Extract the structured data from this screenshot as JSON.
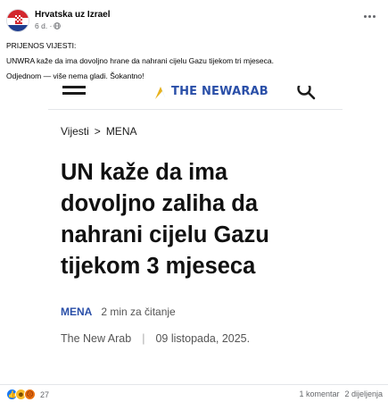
{
  "post": {
    "page_name": "Hrvatska uz Izrael",
    "time": "6 d. ·",
    "audience_icon": "globe-icon",
    "text_lines": [
      "PRIJENOS VIJESTI:",
      "UNWRA kaže da ima dovoljno hrane da nahrani cijelu Gazu tijekom tri mjeseca.",
      "Odjednom — više nema gladi. Šokantno!"
    ]
  },
  "preview": {
    "site_logo_text": "THE NEWARAB",
    "breadcrumb": [
      "Vijesti",
      ">",
      "MENA"
    ],
    "headline": "UN kaže da ima dovoljno zaliha da nahrani cijelu Gazu tijekom 3 mjeseca",
    "category": "MENA",
    "read_time": "2 min za čitanje",
    "source": "The New Arab",
    "separator": "|",
    "date": "09 listopada, 2025."
  },
  "footer": {
    "reaction_count": "27",
    "comments": "1 komentar",
    "shares": "2 dijeljenja"
  },
  "colors": {
    "accent": "#2a4fa8",
    "facebook_blue": "#1877f2",
    "meta_gray": "#65676b"
  }
}
